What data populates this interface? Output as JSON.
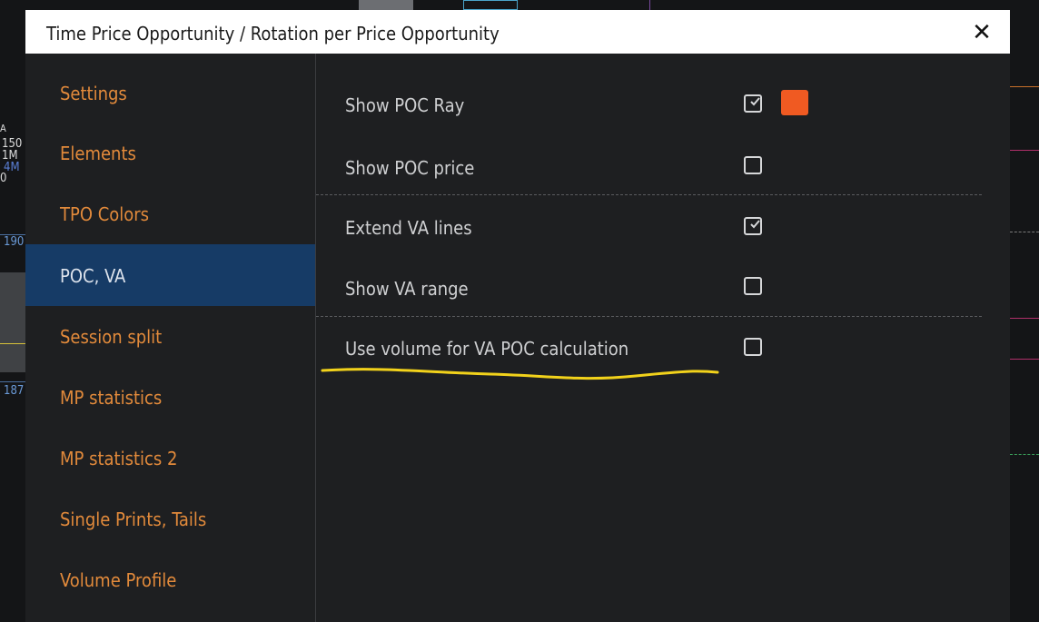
{
  "dialog": {
    "title": "Time Price Opportunity / Rotation per Price Opportunity",
    "close_glyph": "✕"
  },
  "sidebar": {
    "items": [
      {
        "label": "Settings",
        "active": false
      },
      {
        "label": "Elements",
        "active": false
      },
      {
        "label": "TPO Colors",
        "active": false
      },
      {
        "label": "POC, VA",
        "active": true
      },
      {
        "label": "Session split",
        "active": false
      },
      {
        "label": "MP statistics",
        "active": false
      },
      {
        "label": "MP statistics 2",
        "active": false
      },
      {
        "label": "Single Prints, Tails",
        "active": false
      },
      {
        "label": "Volume Profile",
        "active": false
      }
    ]
  },
  "options": [
    {
      "label": "Show POC Ray",
      "checked": true,
      "color": "#f05a22"
    },
    {
      "label": "Show POC price",
      "checked": false
    },
    {
      "label": "Extend VA lines",
      "checked": true
    },
    {
      "label": "Show VA range",
      "checked": false
    },
    {
      "label": "Use volume for VA POC calculation",
      "checked": false
    }
  ],
  "background": {
    "labels": [
      "150",
      "1M",
      "4M",
      "0",
      "190",
      "187"
    ]
  },
  "colors": {
    "accent_orange": "#e28a3b",
    "active_blue": "#163b66",
    "poc_swatch": "#f05a22",
    "highlight_yellow": "#f2d21b"
  }
}
